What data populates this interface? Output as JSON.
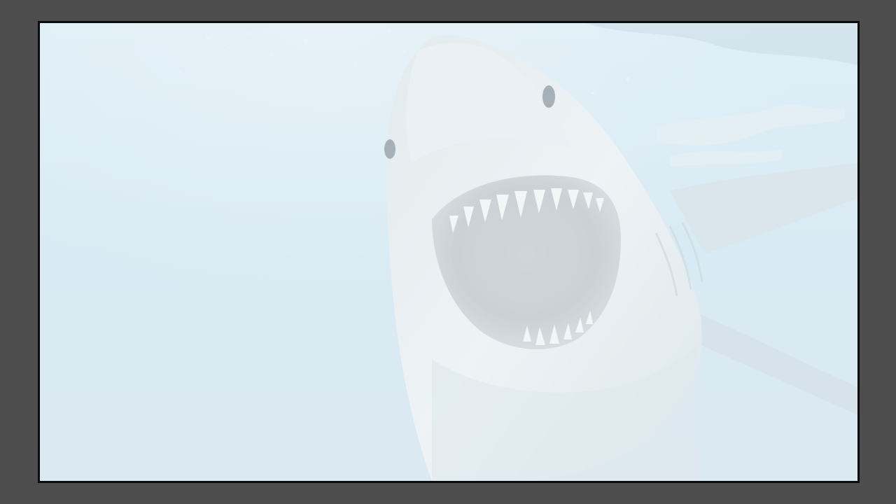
{
  "scene": {
    "subject": "great-white-shark",
    "colors": {
      "outer_background": "#4d4d4d",
      "frame_border": "#0c0c0c",
      "water_light": "#d8ebf4",
      "water_mid": "#cfe4ef",
      "shark_body": "#e9eef0",
      "shark_shadow": "#c9d6dc",
      "mouth_interior": "#bcc5c9",
      "teeth": "#f4f6f6",
      "eye": "#8d9aa0"
    }
  }
}
